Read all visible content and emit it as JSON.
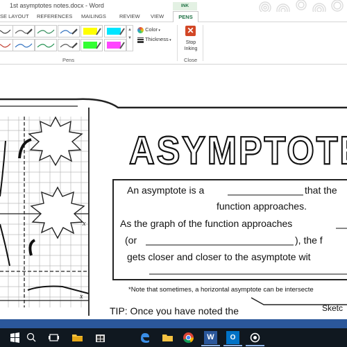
{
  "app": {
    "document_title": "1st asymptotes notes.docx - Word"
  },
  "tabs": {
    "ink_tools_label": "INK TOOLS",
    "items": [
      "SE LAYOUT",
      "REFERENCES",
      "MAILINGS",
      "REVIEW",
      "VIEW"
    ],
    "active": "PENS"
  },
  "ribbon": {
    "color_label": "Color",
    "thickness_label": "Thickness",
    "pens_group_label": "Pens",
    "stop_label_line1": "Stop",
    "stop_label_line2": "Inking",
    "close_group_label": "Close"
  },
  "colors": {
    "accent_green": "#217346",
    "status_bar": "#2b579a",
    "taskbar": "#101820",
    "highlighter_yellow": "#ffff00",
    "highlighter_cyan": "#00e5ff",
    "highlighter_green": "#33ff33",
    "highlighter_magenta": "#ff44ff",
    "stop_icon": "#d24726"
  },
  "worksheet": {
    "title": "ASYMPTOTE",
    "line1a": "An asymptote is a ",
    "line1b": " that the",
    "line2": "function approaches.",
    "line3": "As the graph of the function approaches ",
    "line4a": "(or ",
    "line4b": "), the f",
    "line5": "gets closer and closer to the asymptote wit",
    "note": "*Note that sometimes, a horizontal asymptote can be intersecte",
    "tip": "TIP: Once you have noted the",
    "sketch": "Sketc",
    "axis_x_label": "x"
  },
  "taskbar": {
    "icons": [
      "windows-logo-icon",
      "search-icon",
      "task-view-icon",
      "file-explorer-icon",
      "store-icon",
      "edge-icon",
      "folder-icon",
      "chrome-icon",
      "word-icon",
      "outlook-icon",
      "app-icon"
    ]
  }
}
